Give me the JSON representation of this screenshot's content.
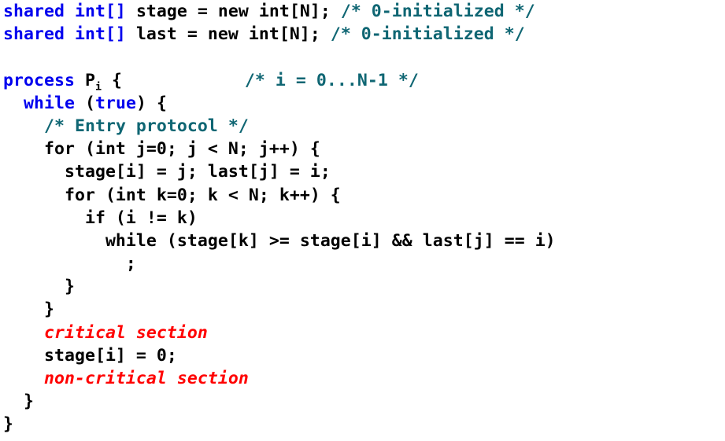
{
  "listing": {
    "title": "Peterson tournament mutual exclusion algorithm pseudocode",
    "language": "pseudocode-c",
    "colors": {
      "background": "#ffffff",
      "keyword": "#0000ee",
      "plain": "#000000",
      "comment": "#0f6673",
      "highlight_red": "#ff0000"
    },
    "lines": [
      {
        "id": "line-1",
        "text": "shared int[] stage = new int[N]; /* 0-initialized */",
        "tokens": [
          {
            "t": "shared int[] ",
            "c": "kw"
          },
          {
            "t": "stage = new int[N]; ",
            "c": "plain"
          },
          {
            "t": "/* 0-initialized */",
            "c": "comment"
          }
        ]
      },
      {
        "id": "line-2",
        "text": "shared int[] last = new int[N]; /* 0-initialized */",
        "tokens": [
          {
            "t": "shared int[] ",
            "c": "kw"
          },
          {
            "t": "last = new int[N]; ",
            "c": "plain"
          },
          {
            "t": "/* 0-initialized */",
            "c": "comment"
          }
        ]
      },
      {
        "id": "line-3",
        "text": "",
        "tokens": []
      },
      {
        "id": "line-4",
        "text": "process Pᵢ {        /* i = 0...N-1 */",
        "tokens": [
          {
            "t": "process",
            "c": "kw"
          },
          {
            "t": " P",
            "c": "plain"
          },
          {
            "t": "i",
            "c": "plain",
            "sub": true
          },
          {
            "t": " {            ",
            "c": "plain"
          },
          {
            "t": "/* i = 0...N-1 */",
            "c": "comment"
          }
        ]
      },
      {
        "id": "line-5",
        "text": "  while (true) {",
        "tokens": [
          {
            "t": "  ",
            "c": "plain"
          },
          {
            "t": "while",
            "c": "kw"
          },
          {
            "t": " (",
            "c": "plain"
          },
          {
            "t": "true",
            "c": "kw"
          },
          {
            "t": ") {",
            "c": "plain"
          }
        ]
      },
      {
        "id": "line-6",
        "text": "    /* Entry protocol */",
        "tokens": [
          {
            "t": "    ",
            "c": "plain"
          },
          {
            "t": "/* Entry protocol */",
            "c": "comment"
          }
        ]
      },
      {
        "id": "line-7",
        "text": "    for (int j=0; j < N; j++) {",
        "tokens": [
          {
            "t": "    for (int j=0; j < N; j++) {",
            "c": "plain"
          }
        ]
      },
      {
        "id": "line-8",
        "text": "      stage[i] = j; last[j] = i;",
        "tokens": [
          {
            "t": "      stage[i] = j; last[j] = i;",
            "c": "plain"
          }
        ]
      },
      {
        "id": "line-9",
        "text": "      for (int k=0; k < N; k++) {",
        "tokens": [
          {
            "t": "      for (int k=0; k < N; k++) {",
            "c": "plain"
          }
        ]
      },
      {
        "id": "line-10",
        "text": "        if (i != k)",
        "tokens": [
          {
            "t": "        if (i != k)",
            "c": "plain"
          }
        ]
      },
      {
        "id": "line-11",
        "text": "          while (stage[k] >= stage[i] && last[j] == i)",
        "tokens": [
          {
            "t": "          while (stage[k] >= stage[i] && last[j] == i)",
            "c": "plain"
          }
        ]
      },
      {
        "id": "line-12",
        "text": "            ;",
        "tokens": [
          {
            "t": "            ;",
            "c": "plain"
          }
        ]
      },
      {
        "id": "line-13",
        "text": "      }",
        "tokens": [
          {
            "t": "      }",
            "c": "plain"
          }
        ]
      },
      {
        "id": "line-14",
        "text": "    }",
        "tokens": [
          {
            "t": "    }",
            "c": "plain"
          }
        ]
      },
      {
        "id": "line-15",
        "text": "    critical section",
        "tokens": [
          {
            "t": "    ",
            "c": "plain"
          },
          {
            "t": "critical section",
            "c": "red"
          }
        ]
      },
      {
        "id": "line-16",
        "text": "    stage[i] = 0;",
        "tokens": [
          {
            "t": "    stage[i] = 0;",
            "c": "plain"
          }
        ]
      },
      {
        "id": "line-17",
        "text": "    non-critical section",
        "tokens": [
          {
            "t": "    ",
            "c": "plain"
          },
          {
            "t": "non-critical section",
            "c": "red"
          }
        ]
      },
      {
        "id": "line-18",
        "text": "  }",
        "tokens": [
          {
            "t": "  }",
            "c": "plain"
          }
        ]
      },
      {
        "id": "line-19",
        "text": "}",
        "tokens": [
          {
            "t": "}",
            "c": "plain"
          }
        ]
      }
    ]
  }
}
